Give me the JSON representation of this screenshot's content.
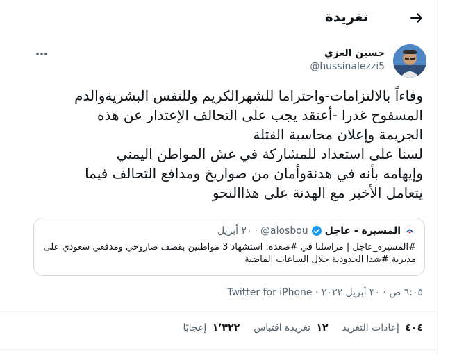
{
  "header": {
    "title": "تغريدة"
  },
  "tweet": {
    "author_name": "حسين العزي",
    "author_handle": "@hussinalezzi5",
    "text": "وفاءاً بالالتزامات-واحتراما للشهرالكريم وللنفس البشريةوالدم\nالمسفوح غدرا -أعتقد يجب على التحالف الإعتذار عن هذه\nالجريمة وإعلان محاسبة القتلة\nلسنا على استعداد للمشاركة في غش المواطن اليمني\nوإيهامه بأنه في هدنةوأمان من صواريخ ومدافع التحالف فيما\nيتعامل الأخير مع الهدنة على هذاالنحو"
  },
  "quote": {
    "name": "المسيرة - عاجل",
    "handle": "@alosbou",
    "separator": "·",
    "time": "٢٠ أبريل",
    "text": "#المسيرة_عاجل | مراسلنا في #صعدة: استشهاد 3 مواطنين بقصف صاروخي ومدفعي سعودي على مديرية #شدا الحدودية خلال الساعات الماضية"
  },
  "meta": {
    "time": "٦:٠٥ ص",
    "separator": "·",
    "date": "٣٠ أبريل ٢٠٢٢",
    "source": "Twitter for iPhone"
  },
  "stats": [
    {
      "count": "٤٠٤",
      "label": "إعادات التغريد"
    },
    {
      "count": "١٢",
      "label": "تغريدة اقتباس"
    },
    {
      "count": "١٬٣٢٢",
      "label": "إعجابًا"
    }
  ],
  "colors": {
    "text": "#0f1419",
    "secondary": "#536471",
    "border": "#cfd9de",
    "verified": "#1d9bf0"
  },
  "icons": {
    "back": "arrow-right-icon",
    "more": "more-horizontal-icon",
    "verified": "verified-badge-icon"
  }
}
